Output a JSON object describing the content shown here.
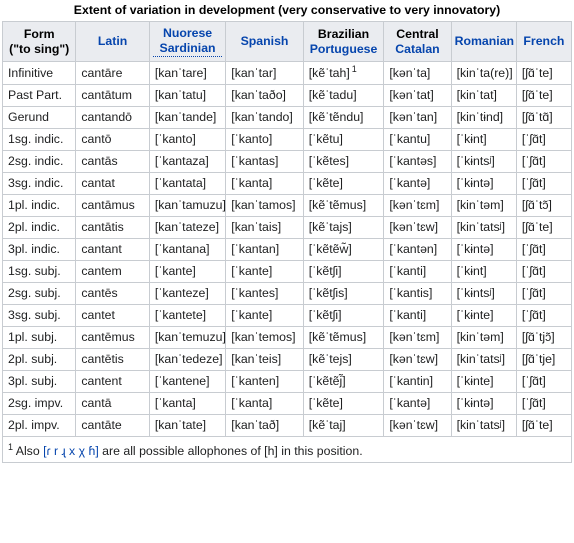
{
  "caption": "Extent of variation in development (very conservative to very innovatory)",
  "columns": [
    {
      "line1": "Form",
      "line2": "(\"to sing\")",
      "line1_link": false,
      "line2_link": false
    },
    {
      "line1": "Latin",
      "line2": "",
      "line1_link": true,
      "line2_link": false
    },
    {
      "line1": "Nuorese",
      "line2": "Sardinian",
      "line1_link": true,
      "line2_link": true,
      "line2_style": "abbr"
    },
    {
      "line1": "Spanish",
      "line2": "",
      "line1_link": true,
      "line2_link": false
    },
    {
      "line1": "Brazilian",
      "line2": "Portuguese",
      "line1_link": false,
      "line2_link": true
    },
    {
      "line1": "Central",
      "line2": "Catalan",
      "line1_link": false,
      "line2_link": true
    },
    {
      "line1": "Romanian",
      "line2": "",
      "line1_link": true,
      "line2_link": false
    },
    {
      "line1": "French",
      "line2": "",
      "line1_link": true,
      "line2_link": false
    }
  ],
  "rows": [
    {
      "form": "Infinitive",
      "latin": "cantāre",
      "sardinian": "[kanˈtare]",
      "spanish": "[kanˈtar]",
      "portuguese": "[kẽˈtah]",
      "portuguese_footnote": "1",
      "catalan": "[kənˈta]",
      "romanian": "[kinˈta(re)]",
      "french": "[ʃɑ̃ˈte]"
    },
    {
      "form": "Past Part.",
      "latin": "cantātum",
      "sardinian": "[kanˈtatu]",
      "spanish": "[kanˈtaðo]",
      "portuguese": "[kẽˈtadu]",
      "portuguese_footnote": "",
      "catalan": "[kənˈtat]",
      "romanian": "[kinˈtat]",
      "french": "[ʃɑ̃ˈte]"
    },
    {
      "form": "Gerund",
      "latin": "cantandō",
      "sardinian": "[kanˈtande]",
      "spanish": "[kanˈtando]",
      "portuguese": "[kẽˈtẽndu]",
      "portuguese_footnote": "",
      "catalan": "[kənˈtan]",
      "romanian": "[kinˈtɨnd]",
      "french": "[ʃɑ̃ˈtɑ̃]"
    },
    {
      "form": "1sg. indic.",
      "latin": "cantō",
      "sardinian": "[ˈkanto]",
      "spanish": "[ˈkanto]",
      "portuguese": "[ˈkẽtu]",
      "portuguese_footnote": "",
      "catalan": "[ˈkantu]",
      "romanian": "[ˈkɨnt]",
      "french": "[ˈʃɑ̃t]"
    },
    {
      "form": "2sg. indic.",
      "latin": "cantās",
      "sardinian": "[ˈkantaza]",
      "spanish": "[ˈkantas]",
      "portuguese": "[ˈkẽtes]",
      "portuguese_footnote": "",
      "catalan": "[ˈkantəs]",
      "romanian": "[ˈkɨntsʲ]",
      "french": "[ˈʃɑ̃t]"
    },
    {
      "form": "3sg. indic.",
      "latin": "cantat",
      "sardinian": "[ˈkantata]",
      "spanish": "[ˈkanta]",
      "portuguese": "[ˈkẽte]",
      "portuguese_footnote": "",
      "catalan": "[ˈkantə]",
      "romanian": "[ˈkɨntə]",
      "french": "[ˈʃɑ̃t]"
    },
    {
      "form": "1pl. indic.",
      "latin": "cantāmus",
      "sardinian": "[kanˈtamuzu]",
      "spanish": "[kanˈtamos]",
      "portuguese": "[kẽˈtẽmus]",
      "portuguese_footnote": "",
      "catalan": "[kənˈtɛm]",
      "romanian": "[kinˈtəm]",
      "french": "[ʃɑ̃ˈtɔ̃]"
    },
    {
      "form": "2pl. indic.",
      "latin": "cantātis",
      "sardinian": "[kanˈtateze]",
      "spanish": "[kanˈtais]",
      "portuguese": "[kẽˈtajs]",
      "portuguese_footnote": "",
      "catalan": "[kənˈtɛw]",
      "romanian": "[kinˈtatsʲ]",
      "french": "[ʃɑ̃ˈte]"
    },
    {
      "form": "3pl. indic.",
      "latin": "cantant",
      "sardinian": "[ˈkantana]",
      "spanish": "[ˈkantan]",
      "portuguese": "[ˈkẽtẽw̃]",
      "portuguese_footnote": "",
      "catalan": "[ˈkantən]",
      "romanian": "[ˈkɨntə]",
      "french": "[ˈʃɑ̃t]"
    },
    {
      "form": "1sg. subj.",
      "latin": "cantem",
      "sardinian": "[ˈkante]",
      "spanish": "[ˈkante]",
      "portuguese": "[ˈkẽtʃi]",
      "portuguese_footnote": "",
      "catalan": "[ˈkanti]",
      "romanian": "[ˈkɨnt]",
      "french": "[ˈʃɑ̃t]"
    },
    {
      "form": "2sg. subj.",
      "latin": "cantēs",
      "sardinian": "[ˈkanteze]",
      "spanish": "[ˈkantes]",
      "portuguese": "[ˈkẽtʃis]",
      "portuguese_footnote": "",
      "catalan": "[ˈkantis]",
      "romanian": "[ˈkɨntsʲ]",
      "french": "[ˈʃɑ̃t]"
    },
    {
      "form": "3sg. subj.",
      "latin": "cantet",
      "sardinian": "[ˈkantete]",
      "spanish": "[ˈkante]",
      "portuguese": "[ˈkẽtʃi]",
      "portuguese_footnote": "",
      "catalan": "[ˈkanti]",
      "romanian": "[ˈkɨnte]",
      "french": "[ˈʃɑ̃t]"
    },
    {
      "form": "1pl. subj.",
      "latin": "cantēmus",
      "sardinian": "[kanˈtemuzu]",
      "spanish": "[kanˈtemos]",
      "portuguese": "[kẽˈtẽmus]",
      "portuguese_footnote": "",
      "catalan": "[kənˈtɛm]",
      "romanian": "[kinˈtəm]",
      "french": "[ʃɑ̃ˈtjɔ̃]"
    },
    {
      "form": "2pl. subj.",
      "latin": "cantētis",
      "sardinian": "[kanˈtedeze]",
      "spanish": "[kanˈteis]",
      "portuguese": "[kẽˈtejs]",
      "portuguese_footnote": "",
      "catalan": "[kənˈtɛw]",
      "romanian": "[kinˈtatsʲ]",
      "french": "[ʃɑ̃ˈtje]"
    },
    {
      "form": "3pl. subj.",
      "latin": "cantent",
      "sardinian": "[ˈkantene]",
      "spanish": "[ˈkanten]",
      "portuguese": "[ˈkẽtẽj̃]",
      "portuguese_footnote": "",
      "catalan": "[ˈkantin]",
      "romanian": "[ˈkɨnte]",
      "french": "[ˈʃɑ̃t]"
    },
    {
      "form": "2sg. impv.",
      "latin": "cantā",
      "sardinian": "[ˈkanta]",
      "spanish": "[ˈkanta]",
      "portuguese": "[ˈkẽte]",
      "portuguese_footnote": "",
      "catalan": "[ˈkantə]",
      "romanian": "[ˈkɨntə]",
      "french": "[ˈʃɑ̃t]"
    },
    {
      "form": "2pl. impv.",
      "latin": "cantāte",
      "sardinian": "[kanˈtate]",
      "spanish": "[kanˈtað]",
      "portuguese": "[kẽˈtaj]",
      "portuguese_footnote": "",
      "catalan": "[kənˈtɛw]",
      "romanian": "[kinˈtatsʲ]",
      "french": "[ʃɑ̃ˈte]"
    }
  ],
  "footnote": {
    "marker": "1",
    "text_before": " Also ",
    "ipa_link": "[ɾ r ɻ x χ ɦ]",
    "text_after": " are all possible allophones of [h] in this position."
  },
  "colors": {
    "link": "#0645ad",
    "header_bg": "#eaecf0",
    "cell_bg": "#ffffff",
    "footnote_bg": "#f8f9fa",
    "border_outer": "#a2a9b1",
    "border_inner": "#c8ccd1",
    "text": "#202122"
  }
}
